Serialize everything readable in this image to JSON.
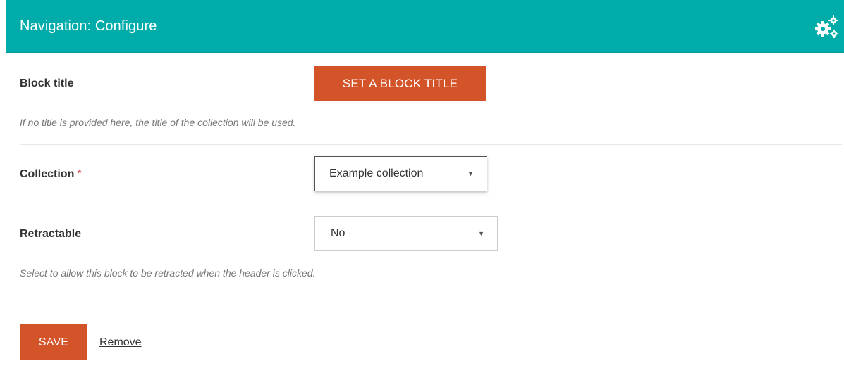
{
  "header": {
    "title": "Navigation: Configure",
    "icon": "gears-icon"
  },
  "block_title": {
    "label": "Block title",
    "button_label": "SET A BLOCK TITLE",
    "help": "If no title is provided here, the title of the collection will be used."
  },
  "collection": {
    "label": "Collection",
    "required_marker": "*",
    "selected": "Example collection"
  },
  "retractable": {
    "label": "Retractable",
    "selected": "No",
    "help": "Select to allow this block to be retracted when the header is clicked."
  },
  "actions": {
    "save_label": "SAVE",
    "remove_label": "Remove"
  },
  "colors": {
    "header_bg": "#00aca9",
    "button_bg": "#d4542a",
    "required": "#d9534f"
  }
}
